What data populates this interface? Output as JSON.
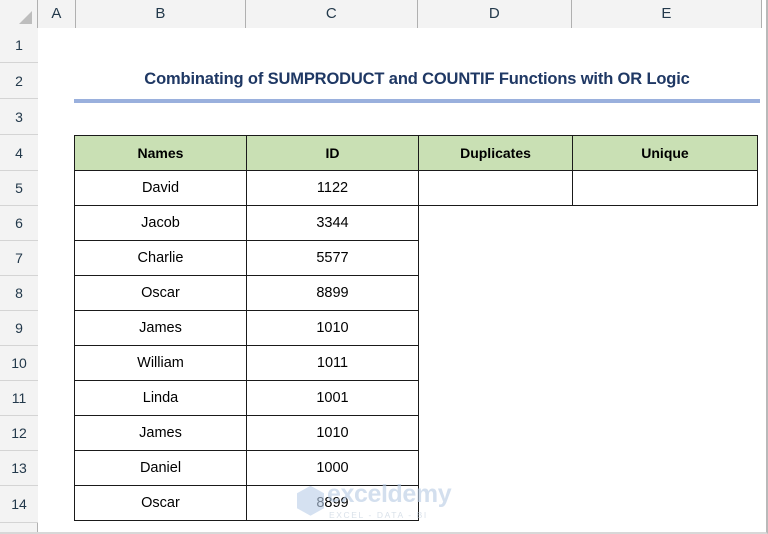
{
  "spreadsheet": {
    "column_headers": [
      "A",
      "B",
      "C",
      "D",
      "E"
    ],
    "row_headers": [
      "1",
      "2",
      "3",
      "4",
      "5",
      "6",
      "7",
      "8",
      "9",
      "10",
      "11",
      "12",
      "13",
      "14"
    ],
    "corner_icon": "select-all-triangle-icon"
  },
  "title": {
    "text": "Combinating of SUMPRODUCT and COUNTIF Functions with OR Logic",
    "color": "#1F3864",
    "underline_color": "#9AB0DD"
  },
  "table": {
    "header_fill": "#C9E0B4",
    "border_color": "#1A1A1A",
    "columns": [
      "Names",
      "ID",
      "Duplicates",
      "Unique"
    ],
    "rows": [
      {
        "name": "David",
        "id": "1122",
        "duplicates": "",
        "unique": "",
        "extra_bordered": true
      },
      {
        "name": "Jacob",
        "id": "3344",
        "duplicates": "",
        "unique": "",
        "extra_bordered": false
      },
      {
        "name": "Charlie",
        "id": "5577",
        "duplicates": "",
        "unique": "",
        "extra_bordered": false
      },
      {
        "name": "Oscar",
        "id": "8899",
        "duplicates": "",
        "unique": "",
        "extra_bordered": false
      },
      {
        "name": "James",
        "id": "1010",
        "duplicates": "",
        "unique": "",
        "extra_bordered": false
      },
      {
        "name": "William",
        "id": "1011",
        "duplicates": "",
        "unique": "",
        "extra_bordered": false
      },
      {
        "name": "Linda",
        "id": "1001",
        "duplicates": "",
        "unique": "",
        "extra_bordered": false
      },
      {
        "name": "James",
        "id": "1010",
        "duplicates": "",
        "unique": "",
        "extra_bordered": false
      },
      {
        "name": "Daniel",
        "id": "1000",
        "duplicates": "",
        "unique": "",
        "extra_bordered": false
      },
      {
        "name": "Oscar",
        "id": "8899",
        "duplicates": "",
        "unique": "",
        "extra_bordered": false
      }
    ]
  },
  "watermark": {
    "name": "exceldemy",
    "tagline": "EXCEL - DATA - BI",
    "logo": "hexagon-logo-icon",
    "color": "#B9CCE4"
  }
}
